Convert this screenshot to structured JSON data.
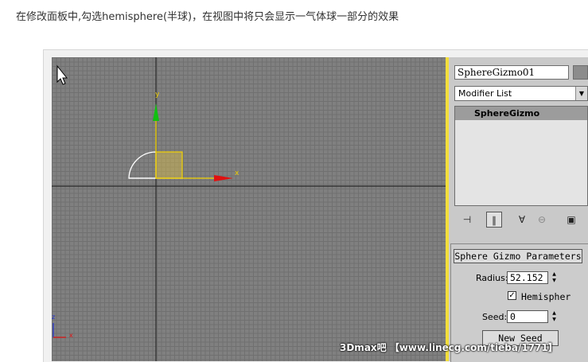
{
  "caption": "在修改面板中,勾选hemisphere(半球)，在视图中将只会显示一气体球一部分的效果",
  "viewport": {
    "axis_y_label": "y",
    "axis_x_label": "x",
    "corner_z_label": "z",
    "corner_x_label": "x"
  },
  "panel": {
    "object_name": "SphereGizmo01",
    "modifier_list": "Modifier List",
    "stack_item": "SphereGizmo",
    "rollout_title": "Sphere Gizmo Parameters",
    "radius_label": "Radius:",
    "radius_value": "52.152",
    "hemisphere_label": "Hemispher",
    "hemisphere_checked": true,
    "seed_label": "Seed:",
    "seed_value": "0",
    "new_seed_button": "New Seed"
  },
  "watermark": "3Dmax吧 【www.linecg.com/tieba/1771】",
  "colors": {
    "viewport_bg": "#808080",
    "grid": "#707070",
    "active_border": "#f3de3a",
    "gizmo_selected": "#f0d000",
    "axis_x": "#e01010",
    "axis_y": "#10c010",
    "panel_bg": "#c9c9c9"
  },
  "icons": [
    "cursor-arrow-icon",
    "pin-stack-icon",
    "show-end-result-icon",
    "make-unique-icon",
    "remove-modifier-icon",
    "configure-modifier-sets-icon"
  ]
}
